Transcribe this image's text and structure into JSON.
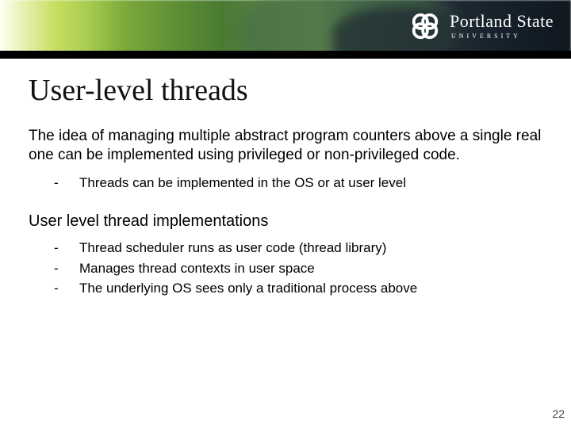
{
  "logo": {
    "name": "Portland State",
    "subline": "UNIVERSITY"
  },
  "title": "User-level threads",
  "para1": "The idea of managing multiple abstract program counters above a single real one can be implemented using privileged or non-privileged code.",
  "list1": [
    "Threads can be implemented in the OS or at user level"
  ],
  "subhead": "User level thread implementations",
  "list2": [
    "Thread scheduler runs as user code (thread library)",
    "Manages thread contexts in user space",
    "The underlying OS sees only a traditional process above"
  ],
  "page_number": "22"
}
